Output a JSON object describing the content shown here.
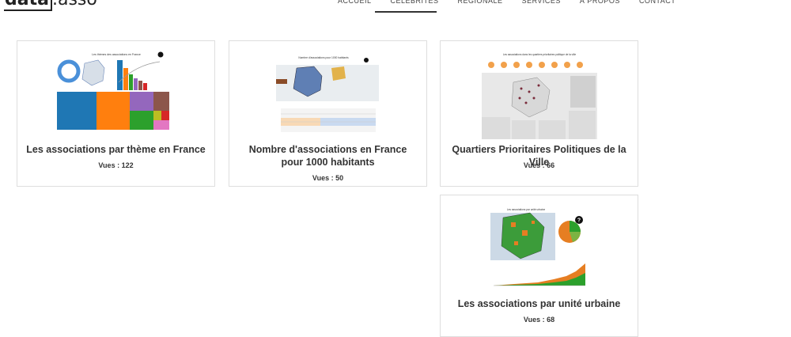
{
  "brand": {
    "logo_bold": "data",
    "logo_thin": ".asso"
  },
  "nav": {
    "items": [
      {
        "label": "ACCUEIL"
      },
      {
        "label": "CÉLÉBRITÉS"
      },
      {
        "label": "RÉGIONALE"
      },
      {
        "label": "SERVICES"
      },
      {
        "label": "À PROPOS"
      },
      {
        "label": "CONTACT"
      }
    ]
  },
  "cards": [
    {
      "title": "Les associations par thème en France",
      "views_label": "Vues : 122",
      "thumb_title": "Les thèmes des associations en France"
    },
    {
      "title": "Nombre d'associations en France pour 1000 habitants",
      "views_label": "Vues : 50",
      "thumb_title": "Nombre d'associations pour 1000 habitants"
    },
    {
      "title": "Quartiers Prioritaires Politiques de la Ville",
      "views_label": "Vues : 66",
      "thumb_title": "Les associations dans les quartiers prioritaires politique de la ville"
    },
    {
      "title": "Les associations par unité urbaine",
      "views_label": "Vues : 68",
      "thumb_title": "Les associations par unité urbaine"
    }
  ],
  "colors": {
    "border": "#dedede",
    "accent_blue": "#1f77b4",
    "accent_orange": "#ff7f0e",
    "accent_green": "#2ca02c",
    "accent_purple": "#9467bd"
  }
}
